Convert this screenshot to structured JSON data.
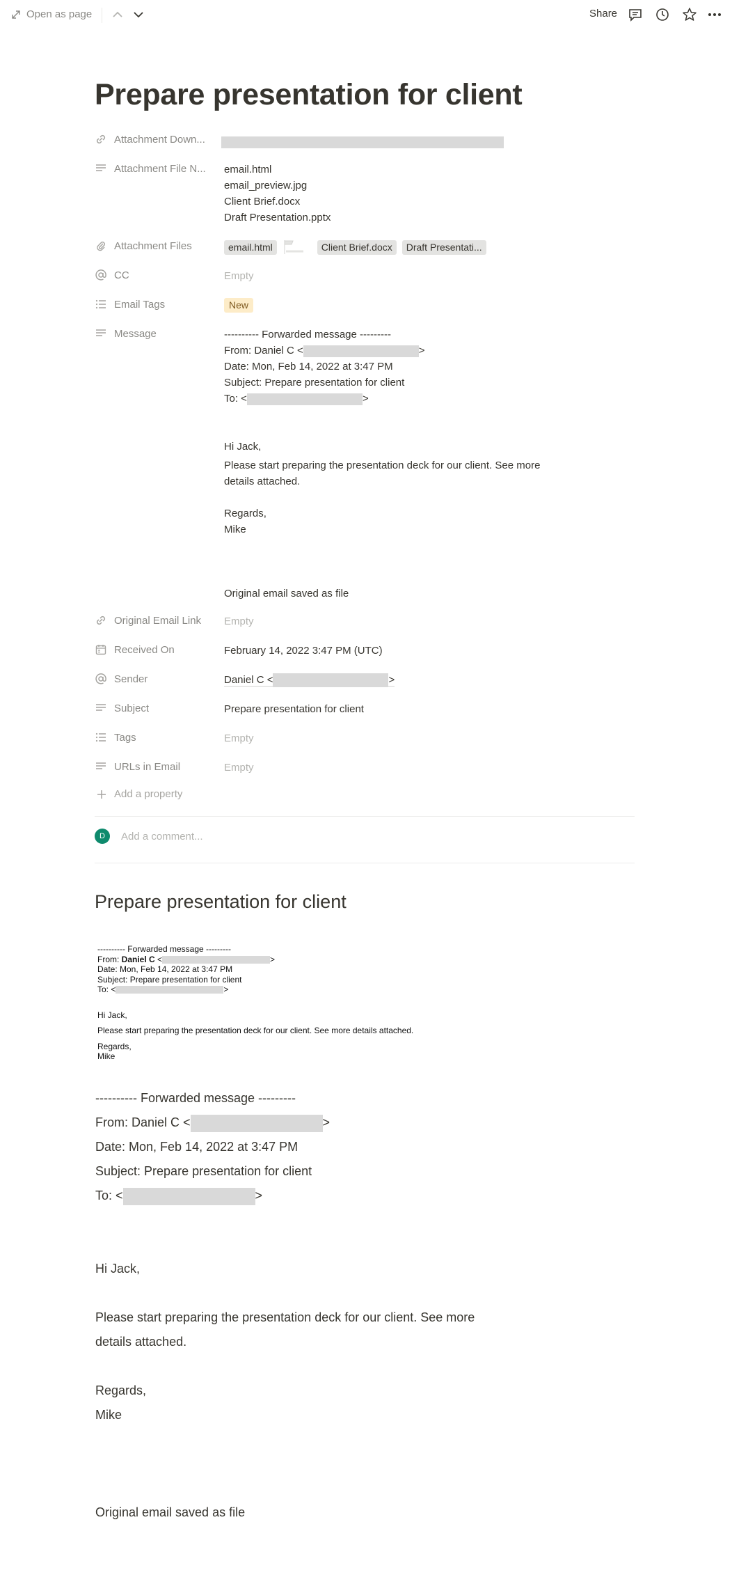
{
  "topbar": {
    "open_as_page": "Open as page",
    "share": "Share"
  },
  "page_title": "Prepare presentation for client",
  "properties": {
    "attachment_download": {
      "label": "Attachment Down..."
    },
    "attachment_file_names": {
      "label": "Attachment File N...",
      "values": [
        "email.html",
        "email_preview.jpg",
        "Client Brief.docx",
        "Draft Presentation.pptx"
      ]
    },
    "attachment_files": {
      "label": "Attachment Files",
      "chips": [
        "email.html",
        "Client Brief.docx",
        "Draft Presentati..."
      ]
    },
    "cc": {
      "label": "CC",
      "value": "Empty"
    },
    "email_tags": {
      "label": "Email Tags",
      "tag": "New"
    },
    "message": {
      "label": "Message",
      "line1": "---------- Forwarded message ---------",
      "from_prefix": "From: Daniel C <",
      "close": ">",
      "date": "Date: Mon, Feb 14, 2022 at 3:47 PM",
      "subject": "Subject: Prepare presentation for client",
      "to_prefix": "To: <",
      "greeting": "Hi Jack,",
      "body": "Please start preparing the presentation deck for our client. See more details attached.",
      "regards": "Regards,",
      "signature": "Mike",
      "footer": "Original email saved as file"
    },
    "original_email_link": {
      "label": "Original Email Link",
      "value": "Empty"
    },
    "received_on": {
      "label": "Received On",
      "value": "February 14, 2022 3:47 PM (UTC)"
    },
    "sender": {
      "label": "Sender",
      "prefix": "Daniel C <",
      "suffix": ">"
    },
    "subject": {
      "label": "Subject",
      "value": "Prepare presentation for client"
    },
    "tags": {
      "label": "Tags",
      "value": "Empty"
    },
    "urls_in_email": {
      "label": "URLs in Email",
      "value": "Empty"
    }
  },
  "add_property": "Add a property",
  "comment": {
    "avatar": "D",
    "placeholder": "Add a comment..."
  },
  "section_heading": "Prepare presentation for client",
  "preview": {
    "line1": "---------- Forwarded message ---------",
    "from_label": "From: ",
    "from_name": "Daniel C",
    "from_open": " <",
    "close": ">",
    "date": "Date: Mon, Feb 14, 2022 at 3:47 PM",
    "subject": "Subject: Prepare presentation for client",
    "to_label": "To: <",
    "greeting": "Hi Jack,",
    "body": "Please start preparing the presentation deck for our client. See more details attached.",
    "regards": "Regards,",
    "signature": "Mike"
  },
  "body": {
    "line1": "---------- Forwarded message ---------",
    "from_prefix": "From: Daniel C <",
    "close": ">",
    "date": "Date: Mon, Feb 14, 2022 at 3:47 PM",
    "subject": "Subject: Prepare presentation for client",
    "to_prefix": "To: <",
    "greeting": "Hi Jack,",
    "body_line1": "Please start preparing the presentation deck for our client. See more",
    "body_line2": "details attached.",
    "regards": "Regards,",
    "signature": "Mike",
    "footer": "Original email saved as file"
  }
}
